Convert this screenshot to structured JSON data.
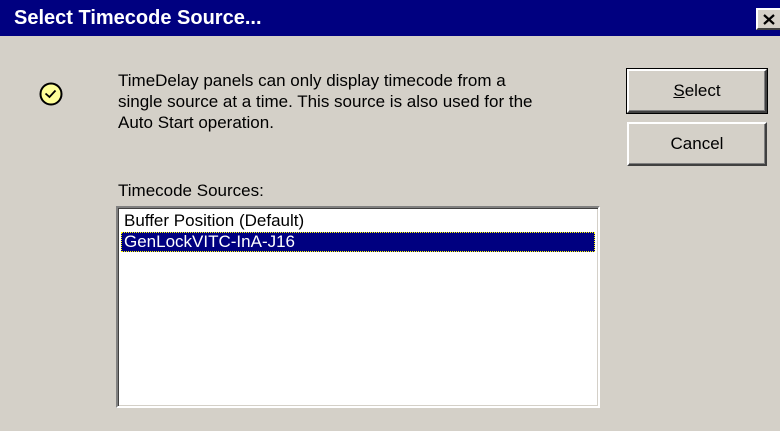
{
  "window": {
    "title": "Select Timecode Source...",
    "close_glyph": "×"
  },
  "message": {
    "icon": "clock-icon",
    "lines": [
      "TimeDelay panels can only display timecode from a",
      "single source at a time. This source is also used for the",
      "Auto Start operation."
    ]
  },
  "buttons": {
    "select": {
      "accel": "S",
      "rest": "elect"
    },
    "cancel": {
      "label": "Cancel"
    }
  },
  "sources": {
    "label": "Timecode Sources:",
    "items": [
      {
        "label": "Buffer Position (Default)",
        "selected": false
      },
      {
        "label": "GenLockVITC-InA-J16",
        "selected": true
      }
    ]
  },
  "colors": {
    "titlebar": "#000080",
    "face": "#d4d0c8",
    "selection": "#000080"
  }
}
